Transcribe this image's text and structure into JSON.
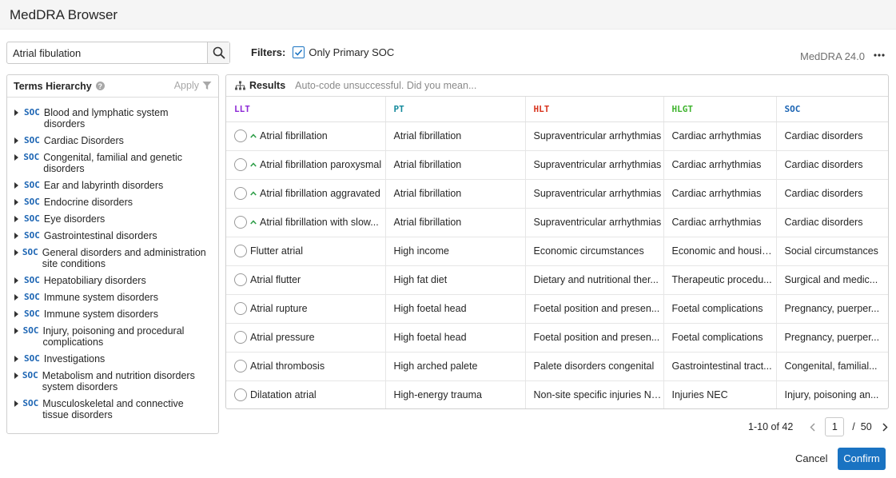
{
  "window": {
    "title": "MedDRA Browser"
  },
  "search": {
    "value": "Atrial fibulation",
    "placeholder": ""
  },
  "filters": {
    "label": "Filters:",
    "only_primary_soc_label": "Only Primary SOC",
    "only_primary_soc_checked": true
  },
  "version": "MedDRA 24.0",
  "hierarchy": {
    "title": "Terms Hierarchy",
    "help_glyph": "?",
    "apply_label": "Apply",
    "tag": "SOC",
    "items": [
      "Blood and lymphatic system disorders",
      "Cardiac Disorders",
      "Congenital, familial and genetic disorders",
      "Ear and labyrinth disorders",
      "Endocrine disorders",
      "Eye disorders",
      "Gastrointestinal disorders",
      "General disorders and administration site conditions",
      "Hepatobiliary disorders",
      "Immune system disorders",
      "Immune system disorders",
      "Injury, poisoning and procedural complications",
      "Investigations",
      "Metabolism and nutrition disorders system disorders",
      "Musculoskeletal and connective tissue disorders"
    ]
  },
  "results": {
    "title": "Results",
    "message": "Auto-code unsuccessful. Did you mean...",
    "columns": [
      {
        "label": "LLT",
        "color": "#8e2bd6"
      },
      {
        "label": "PT",
        "color": "#138a9c"
      },
      {
        "label": "HLT",
        "color": "#d8341e"
      },
      {
        "label": "HLGT",
        "color": "#3fb42e"
      },
      {
        "label": "SOC",
        "color": "#1b64b3"
      }
    ],
    "rows": [
      {
        "primary": true,
        "llt": "Atrial fibrillation",
        "pt": "Atrial fibrillation",
        "hlt": "Supraventricular arrhythmias",
        "hlgt": "Cardiac arrhythmias",
        "soc": "Cardiac disorders"
      },
      {
        "primary": true,
        "llt": "Atrial fibrillation paroxysmal",
        "pt": "Atrial fibrillation",
        "hlt": "Supraventricular arrhythmias",
        "hlgt": "Cardiac arrhythmias",
        "soc": "Cardiac disorders"
      },
      {
        "primary": true,
        "llt": "Atrial fibrillation aggravated",
        "pt": "Atrial fibrillation",
        "hlt": "Supraventricular arrhythmias",
        "hlgt": "Cardiac arrhythmias",
        "soc": "Cardiac disorders"
      },
      {
        "primary": true,
        "llt": "Atrial fibrillation with slow...",
        "pt": "Atrial fibrillation",
        "hlt": "Supraventricular arrhythmias",
        "hlgt": "Cardiac arrhythmias",
        "soc": "Cardiac disorders"
      },
      {
        "primary": false,
        "llt": "Flutter atrial",
        "pt": "High income",
        "hlt": "Economic circumstances",
        "hlgt": "Economic and housing...",
        "soc": "Social circumstances"
      },
      {
        "primary": false,
        "llt": "Atrial flutter",
        "pt": "High fat diet",
        "hlt": "Dietary and nutritional ther...",
        "hlgt": "Therapeutic procedu...",
        "soc": "Surgical and medic..."
      },
      {
        "primary": false,
        "llt": "Atrial rupture",
        "pt": "High foetal head",
        "hlt": "Foetal position and presen...",
        "hlgt": "Foetal complications",
        "soc": "Pregnancy, puerper..."
      },
      {
        "primary": false,
        "llt": "Atrial pressure",
        "pt": "High foetal head",
        "hlt": "Foetal position and presen...",
        "hlgt": "Foetal complications",
        "soc": "Pregnancy, puerper..."
      },
      {
        "primary": false,
        "llt": "Atrial thrombosis",
        "pt": "High arched palete",
        "hlt": "Palete disorders congenital",
        "hlgt": "Gastrointestinal tract...",
        "soc": "Congenital, familial..."
      },
      {
        "primary": false,
        "llt": "Dilatation atrial",
        "pt": "High-energy trauma",
        "hlt": "Non-site specific injuries NEC",
        "hlgt": "Injuries NEC",
        "soc": "Injury, poisoning an..."
      }
    ]
  },
  "pagination": {
    "range": "1-10 of 42",
    "current_page": "1",
    "separator": "/",
    "total_pages": "50"
  },
  "footer": {
    "cancel_label": "Cancel",
    "confirm_label": "Confirm"
  },
  "colors": {
    "accent": "#1a73c2",
    "primary_marker": "#2e9e49"
  }
}
